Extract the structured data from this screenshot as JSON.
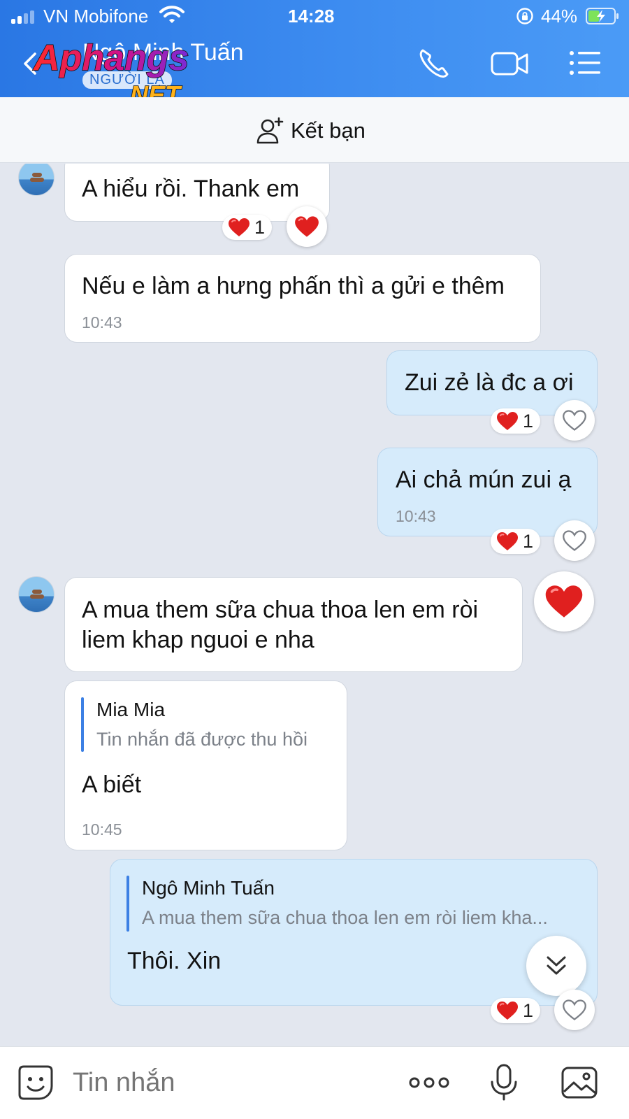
{
  "status_bar": {
    "carrier": "VN Mobifone",
    "time": "14:28",
    "battery": "44%",
    "battery_level": 0.44
  },
  "header": {
    "contact_name": "Ngô Minh Tuấn",
    "subtitle": "NGƯỜI LẠ",
    "watermark": {
      "brand": "Aphangs",
      "suffix": ".NET"
    },
    "icons": [
      "back-icon",
      "phone-icon",
      "video-icon",
      "menu-icon"
    ]
  },
  "add_friend": {
    "label": "Kết bạn",
    "icon": "add-user-icon"
  },
  "messages": [
    {
      "direction": "in",
      "text": "A hiểu rồi. Thank em",
      "time": "",
      "reactions": {
        "heart": "1"
      }
    },
    {
      "direction": "in",
      "text": "Nếu e làm a hưng phấn thì a gửi e thêm",
      "time": "10:43"
    },
    {
      "direction": "out",
      "text": "Zui zẻ là đc a ơi",
      "time": "",
      "reactions": {
        "heart": "1"
      }
    },
    {
      "direction": "out",
      "text": "Ai chả mún zui ạ",
      "time": "10:43",
      "reactions": {
        "heart": "1"
      }
    },
    {
      "direction": "in",
      "text": "A mua them sữa chua thoa len em ròi\nliem khap nguoi e nha",
      "time": ""
    },
    {
      "direction": "in",
      "reply_to": {
        "name": "Mia Mia",
        "text": "Tin nhắn đã được thu hồi"
      },
      "text": "A biết",
      "time": "10:45"
    },
    {
      "direction": "out",
      "reply_to": {
        "name": "Ngô Minh Tuấn",
        "text": "A mua them sữa chua thoa len em ròi liem kha..."
      },
      "text": "Thôi. Xin",
      "time": "",
      "reactions": {
        "heart": "1"
      }
    }
  ],
  "input_bar": {
    "placeholder": "Tin nhắn",
    "icons": [
      "sticker-icon",
      "more-icon",
      "microphone-icon",
      "image-icon"
    ]
  },
  "colors": {
    "header": "#3d8cf0",
    "chat_background": "#e3e7ef",
    "incoming_bubble": "#ffffff",
    "outgoing_bubble": "#d6ebfb",
    "heart": "#e0201f",
    "reply_bar": "#3c80e4"
  }
}
